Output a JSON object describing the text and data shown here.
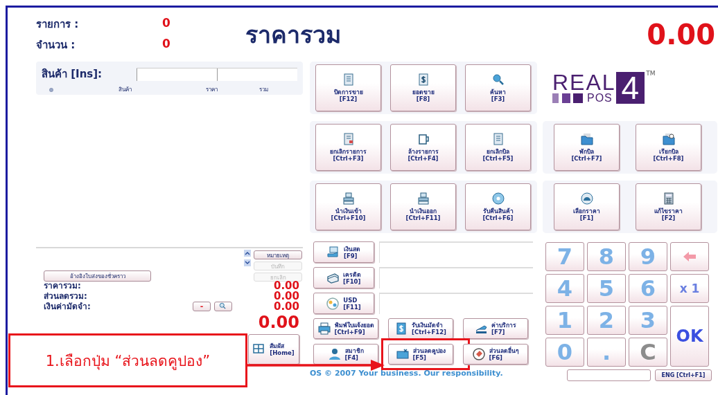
{
  "header": {
    "items_label": "รายการ :",
    "items_value": "0",
    "qty_label": "จำนวน :",
    "qty_value": "0",
    "total_title": "ราคารวม",
    "total_value": "0.00"
  },
  "product_entry": {
    "label": "สินค้า [Ins]:"
  },
  "table": {
    "columns": [
      "สินค้า",
      "ราคา",
      "รวม"
    ]
  },
  "note_buttons": [
    {
      "label": "หมายเหตุ",
      "disabled": false
    },
    {
      "label": "บันทึก",
      "disabled": true
    },
    {
      "label": "ยกเลิก",
      "disabled": true
    }
  ],
  "reference_button": "อ้างอิงใบส่งของชั่วคราว",
  "summary": [
    {
      "label": "ราคารวม:",
      "value": "0.00",
      "kind": "plain"
    },
    {
      "label": "ส่วนลดรวม:",
      "value": "0.00",
      "kind": "plain"
    },
    {
      "label": "เงินค่ามัดจำ:",
      "value": "0.00",
      "kind": "deposit",
      "button": "-"
    }
  ],
  "net_total": "0.00",
  "touch_button": {
    "label": "สัมผัส",
    "shortcut": "[Home]"
  },
  "function_rows": [
    [
      {
        "label": "ปิดการขาย",
        "shortcut": "[F12]"
      },
      {
        "label": "ยอดขาย",
        "shortcut": "[F8]"
      },
      {
        "label": "ค้นหา",
        "shortcut": "[F3]"
      }
    ],
    [
      {
        "label": "ยกเลิกรายการ",
        "shortcut": "[Ctrl+F3]"
      },
      {
        "label": "ล้างรายการ",
        "shortcut": "[Ctrl+F4]"
      },
      {
        "label": "ยกเลิกบิล",
        "shortcut": "[Ctrl+F5]"
      }
    ],
    [
      {
        "label": "นำเงินเข้า",
        "shortcut": "[Ctrl+F10]"
      },
      {
        "label": "นำเงินออก",
        "shortcut": "[Ctrl+F11]"
      },
      {
        "label": "รับคืนสินค้า",
        "shortcut": "[Ctrl+F6]"
      }
    ]
  ],
  "logo": {
    "word": "REAL",
    "sub": "POS",
    "number": "4",
    "mark": "TM"
  },
  "bill_rows": [
    [
      {
        "label": "พักบิล",
        "shortcut": "[Ctrl+F7]"
      },
      {
        "label": "เรียกบิล",
        "shortcut": "[Ctrl+F8]"
      }
    ],
    [
      {
        "label": "เลือกราคา",
        "shortcut": "[F1]"
      },
      {
        "label": "แก้ไขราคา",
        "shortcut": "[F2]"
      }
    ]
  ],
  "payment_methods": [
    {
      "label": "เงินสด",
      "shortcut": "[F9]"
    },
    {
      "label": "เครดิต",
      "shortcut": "[F10]"
    },
    {
      "label": "USD",
      "shortcut": "[F11]"
    }
  ],
  "action_buttons": [
    {
      "label": "พิมพ์ใบแจ้งยอด",
      "shortcut": "[Ctrl+F9]",
      "highlighted": false
    },
    {
      "label": "รับเงินมัดจำ",
      "shortcut": "[Ctrl+F12]",
      "highlighted": false
    },
    {
      "label": "ค่าบริการ",
      "shortcut": "[F7]",
      "highlighted": false
    },
    {
      "label": "สมาชิก",
      "shortcut": "[F4]",
      "highlighted": false
    },
    {
      "label": "ส่วนลดคูปอง",
      "shortcut": "[F5]",
      "highlighted": true
    },
    {
      "label": "ส่วนลดอื่นๆ",
      "shortcut": "[F6]",
      "highlighted": false
    }
  ],
  "keypad": [
    {
      "label": "7",
      "kind": "digit"
    },
    {
      "label": "8",
      "kind": "digit"
    },
    {
      "label": "9",
      "kind": "digit"
    },
    {
      "kind": "back"
    },
    {
      "label": "4",
      "kind": "digit"
    },
    {
      "label": "5",
      "kind": "digit"
    },
    {
      "label": "6",
      "kind": "digit"
    },
    {
      "label": "x 1",
      "kind": "multiplier"
    },
    {
      "label": "1",
      "kind": "digit"
    },
    {
      "label": "2",
      "kind": "digit"
    },
    {
      "label": "3",
      "kind": "digit"
    },
    {
      "label": "OK",
      "kind": "ok"
    },
    {
      "label": "0",
      "kind": "digit"
    },
    {
      "label": ".",
      "kind": "digit"
    },
    {
      "label": "C",
      "kind": "clear"
    }
  ],
  "footer": {
    "text": "OS © 2007 Your business. Our responsibility.",
    "language_button": "ENG [Ctrl+F1]"
  },
  "annotation": {
    "text": "1.เลือกปุ่ม “ส่วนลดคูปอง”"
  }
}
